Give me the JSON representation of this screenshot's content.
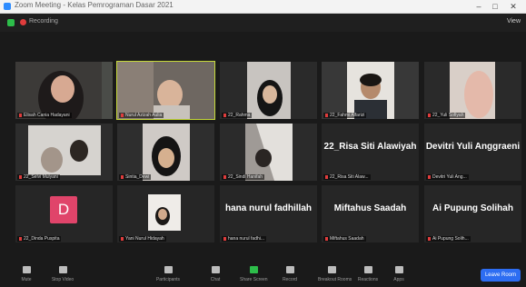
{
  "window": {
    "title": "Zoom Meeting - Kelas Pemrograman Dasar 2021"
  },
  "top": {
    "recording": "Recording",
    "view": "View"
  },
  "tiles": [
    {
      "name": "Elisah Cania Hadayani",
      "kind": "video"
    },
    {
      "name": "Nurul Azizah Aulia",
      "kind": "video",
      "active": true
    },
    {
      "name": "22_Rahma",
      "kind": "video"
    },
    {
      "name": "22_Fahmi Alfarizi",
      "kind": "video"
    },
    {
      "name": "22_Yuli Sofiyah",
      "kind": "video"
    },
    {
      "name": "22_Selvi Mulyani",
      "kind": "video"
    },
    {
      "name": "Sintia_Dewi",
      "kind": "video"
    },
    {
      "name": "22_Sindi Hanifah",
      "kind": "video"
    },
    {
      "name": "22_Risa Siti Alaw...",
      "kind": "name",
      "label": "22_Risa Siti Alawiyah"
    },
    {
      "name": "Devitri Yuli Ang...",
      "kind": "name",
      "label": "Devitri Yuli Anggraeni"
    },
    {
      "name": "22_Dinda Puspita",
      "kind": "avatar",
      "initial": "D"
    },
    {
      "name": "Yani Nurul Hidayah",
      "kind": "video"
    },
    {
      "name": "hana nurul fadhi...",
      "kind": "name",
      "label": "hana nurul fadhillah"
    },
    {
      "name": "Miftahus Saadah",
      "kind": "name",
      "label": "Miftahus Saadah"
    },
    {
      "name": "Ai Pupung Solih...",
      "kind": "name",
      "label": "Ai Pupung Solihah"
    }
  ],
  "toolbar": {
    "items": [
      {
        "label": "Mute",
        "icon": "mic-icon"
      },
      {
        "label": "Stop Video",
        "icon": "video-icon"
      },
      {
        "label": "Participants",
        "icon": "participants-icon"
      },
      {
        "label": "Chat",
        "icon": "chat-icon"
      },
      {
        "label": "Share Screen",
        "icon": "share-icon"
      },
      {
        "label": "Record",
        "icon": "record-icon"
      },
      {
        "label": "Breakout Rooms",
        "icon": "breakout-icon"
      },
      {
        "label": "Reactions",
        "icon": "reactions-icon"
      },
      {
        "label": "Apps",
        "icon": "apps-icon"
      }
    ],
    "leave": "Leave Room"
  }
}
